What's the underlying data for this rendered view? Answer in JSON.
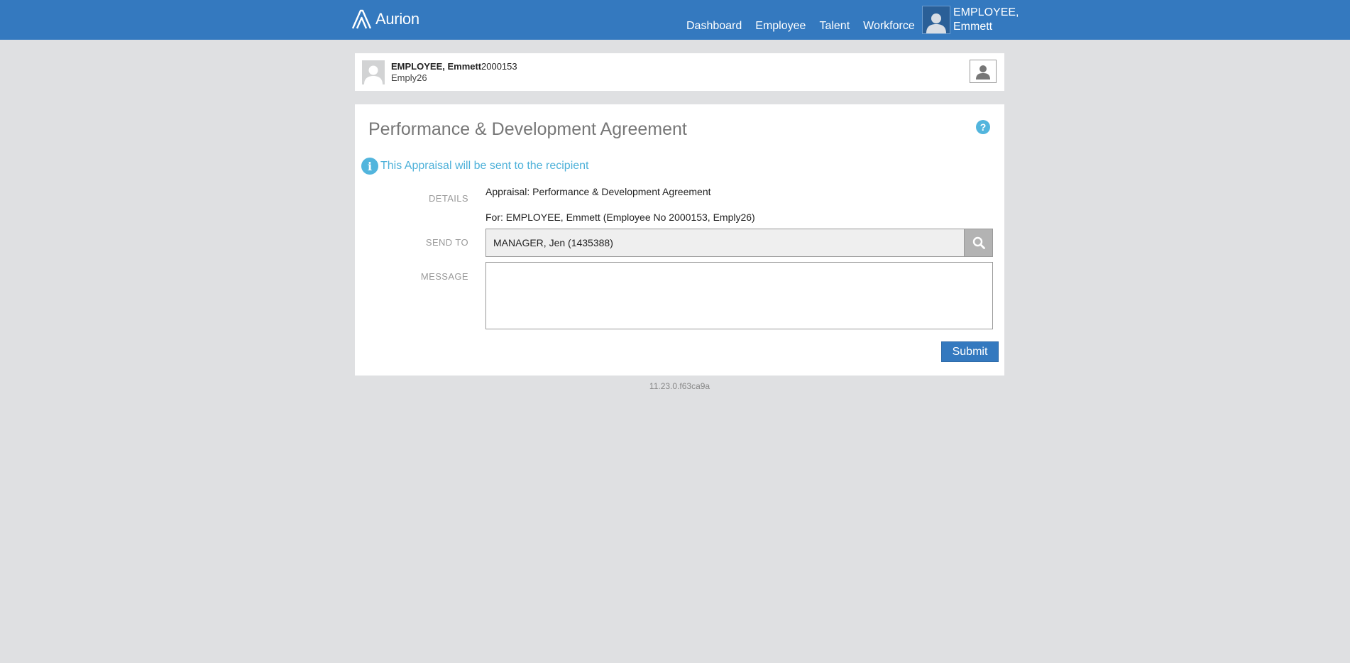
{
  "app": {
    "name": "Aurion"
  },
  "nav": {
    "items": [
      "Dashboard",
      "Employee",
      "Talent",
      "Workforce"
    ]
  },
  "user": {
    "name_line1": "EMPLOYEE,",
    "name_line2": "Emmett"
  },
  "employee": {
    "name": "EMPLOYEE, Emmett",
    "number": "2000153",
    "username": "Emply26"
  },
  "page": {
    "title": "Performance & Development Agreement",
    "info_message": "This Appraisal will be sent to the recipient"
  },
  "form": {
    "details_label": "DETAILS",
    "details_line1": "Appraisal: Performance & Development Agreement",
    "details_line2": "For: EMPLOYEE, Emmett (Employee No 2000153, Emply26)",
    "sendto_label": "SEND TO",
    "sendto_value": "MANAGER, Jen (1435388)",
    "message_label": "MESSAGE",
    "message_value": "",
    "submit_label": "Submit"
  },
  "footer": {
    "version": "11.23.0.f63ca9a"
  },
  "colors": {
    "header": "#3479bf",
    "accent": "#52b5dd",
    "background": "#dfe0e2"
  },
  "icons": [
    "aurion-logo",
    "user-avatar-icon",
    "profile-icon",
    "help-icon",
    "info-icon",
    "search-icon"
  ]
}
